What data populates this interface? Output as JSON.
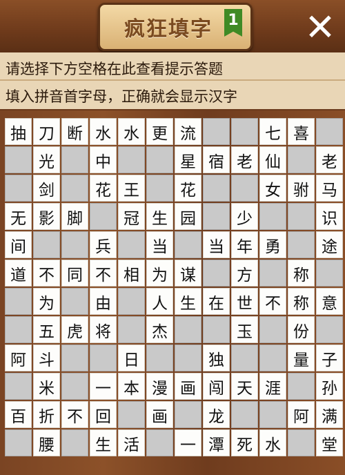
{
  "header": {
    "title": "疯狂填字",
    "level": "1",
    "close_icon": "close-icon"
  },
  "hints": {
    "line1": "请选择下方空格在此查看提示答题",
    "line2": "填入拼音首字母，正确就会显示汉字"
  },
  "grid": [
    [
      "抽",
      "刀",
      "断",
      "水",
      "水",
      "更",
      "流",
      "",
      "",
      "七",
      "喜",
      ""
    ],
    [
      "",
      "光",
      "",
      "中",
      "",
      "",
      "星",
      "宿",
      "老",
      "仙",
      "",
      "老"
    ],
    [
      "",
      "剑",
      "",
      "花",
      "王",
      "",
      "花",
      "",
      "",
      "女",
      "驸",
      "马"
    ],
    [
      "无",
      "影",
      "脚",
      "",
      "冠",
      "生",
      "园",
      "",
      "少",
      "",
      "",
      "识"
    ],
    [
      "间",
      "",
      "",
      "兵",
      "",
      "当",
      "",
      "当",
      "年",
      "勇",
      "",
      "途"
    ],
    [
      "道",
      "不",
      "同",
      "不",
      "相",
      "为",
      "谋",
      "",
      "方",
      "",
      "称",
      ""
    ],
    [
      "",
      "为",
      "",
      "由",
      "",
      "人",
      "生",
      "在",
      "世",
      "不",
      "称",
      "意"
    ],
    [
      "",
      "五",
      "虎",
      "将",
      "",
      "杰",
      "",
      "",
      "玉",
      "",
      "份",
      ""
    ],
    [
      "阿",
      "斗",
      "",
      "",
      "日",
      "",
      "",
      "独",
      "",
      "",
      "量",
      "子"
    ],
    [
      "",
      "米",
      "",
      "一",
      "本",
      "漫",
      "画",
      "闯",
      "天",
      "涯",
      "",
      "孙"
    ],
    [
      "百",
      "折",
      "不",
      "回",
      "",
      "画",
      "",
      "龙",
      "",
      "",
      "阿",
      "满"
    ],
    [
      "",
      "腰",
      "",
      "生",
      "活",
      "",
      "一",
      "潭",
      "死",
      "水",
      "",
      "堂"
    ]
  ]
}
